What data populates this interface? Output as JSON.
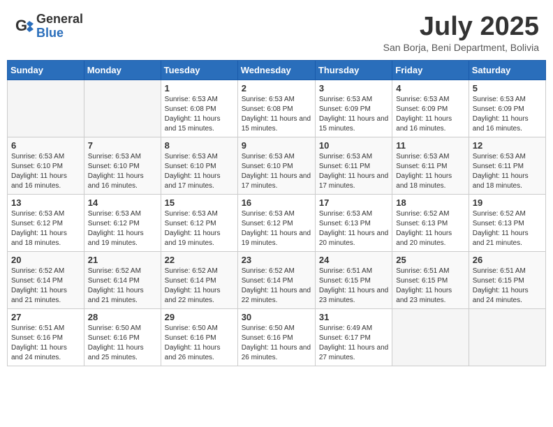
{
  "header": {
    "logo_general": "General",
    "logo_blue": "Blue",
    "month_title": "July 2025",
    "location": "San Borja, Beni Department, Bolivia"
  },
  "weekdays": [
    "Sunday",
    "Monday",
    "Tuesday",
    "Wednesday",
    "Thursday",
    "Friday",
    "Saturday"
  ],
  "weeks": [
    [
      {
        "day": "",
        "info": ""
      },
      {
        "day": "",
        "info": ""
      },
      {
        "day": "1",
        "info": "Sunrise: 6:53 AM\nSunset: 6:08 PM\nDaylight: 11 hours and 15 minutes."
      },
      {
        "day": "2",
        "info": "Sunrise: 6:53 AM\nSunset: 6:08 PM\nDaylight: 11 hours and 15 minutes."
      },
      {
        "day": "3",
        "info": "Sunrise: 6:53 AM\nSunset: 6:09 PM\nDaylight: 11 hours and 15 minutes."
      },
      {
        "day": "4",
        "info": "Sunrise: 6:53 AM\nSunset: 6:09 PM\nDaylight: 11 hours and 16 minutes."
      },
      {
        "day": "5",
        "info": "Sunrise: 6:53 AM\nSunset: 6:09 PM\nDaylight: 11 hours and 16 minutes."
      }
    ],
    [
      {
        "day": "6",
        "info": "Sunrise: 6:53 AM\nSunset: 6:10 PM\nDaylight: 11 hours and 16 minutes."
      },
      {
        "day": "7",
        "info": "Sunrise: 6:53 AM\nSunset: 6:10 PM\nDaylight: 11 hours and 16 minutes."
      },
      {
        "day": "8",
        "info": "Sunrise: 6:53 AM\nSunset: 6:10 PM\nDaylight: 11 hours and 17 minutes."
      },
      {
        "day": "9",
        "info": "Sunrise: 6:53 AM\nSunset: 6:10 PM\nDaylight: 11 hours and 17 minutes."
      },
      {
        "day": "10",
        "info": "Sunrise: 6:53 AM\nSunset: 6:11 PM\nDaylight: 11 hours and 17 minutes."
      },
      {
        "day": "11",
        "info": "Sunrise: 6:53 AM\nSunset: 6:11 PM\nDaylight: 11 hours and 18 minutes."
      },
      {
        "day": "12",
        "info": "Sunrise: 6:53 AM\nSunset: 6:11 PM\nDaylight: 11 hours and 18 minutes."
      }
    ],
    [
      {
        "day": "13",
        "info": "Sunrise: 6:53 AM\nSunset: 6:12 PM\nDaylight: 11 hours and 18 minutes."
      },
      {
        "day": "14",
        "info": "Sunrise: 6:53 AM\nSunset: 6:12 PM\nDaylight: 11 hours and 19 minutes."
      },
      {
        "day": "15",
        "info": "Sunrise: 6:53 AM\nSunset: 6:12 PM\nDaylight: 11 hours and 19 minutes."
      },
      {
        "day": "16",
        "info": "Sunrise: 6:53 AM\nSunset: 6:12 PM\nDaylight: 11 hours and 19 minutes."
      },
      {
        "day": "17",
        "info": "Sunrise: 6:53 AM\nSunset: 6:13 PM\nDaylight: 11 hours and 20 minutes."
      },
      {
        "day": "18",
        "info": "Sunrise: 6:52 AM\nSunset: 6:13 PM\nDaylight: 11 hours and 20 minutes."
      },
      {
        "day": "19",
        "info": "Sunrise: 6:52 AM\nSunset: 6:13 PM\nDaylight: 11 hours and 21 minutes."
      }
    ],
    [
      {
        "day": "20",
        "info": "Sunrise: 6:52 AM\nSunset: 6:14 PM\nDaylight: 11 hours and 21 minutes."
      },
      {
        "day": "21",
        "info": "Sunrise: 6:52 AM\nSunset: 6:14 PM\nDaylight: 11 hours and 21 minutes."
      },
      {
        "day": "22",
        "info": "Sunrise: 6:52 AM\nSunset: 6:14 PM\nDaylight: 11 hours and 22 minutes."
      },
      {
        "day": "23",
        "info": "Sunrise: 6:52 AM\nSunset: 6:14 PM\nDaylight: 11 hours and 22 minutes."
      },
      {
        "day": "24",
        "info": "Sunrise: 6:51 AM\nSunset: 6:15 PM\nDaylight: 11 hours and 23 minutes."
      },
      {
        "day": "25",
        "info": "Sunrise: 6:51 AM\nSunset: 6:15 PM\nDaylight: 11 hours and 23 minutes."
      },
      {
        "day": "26",
        "info": "Sunrise: 6:51 AM\nSunset: 6:15 PM\nDaylight: 11 hours and 24 minutes."
      }
    ],
    [
      {
        "day": "27",
        "info": "Sunrise: 6:51 AM\nSunset: 6:16 PM\nDaylight: 11 hours and 24 minutes."
      },
      {
        "day": "28",
        "info": "Sunrise: 6:50 AM\nSunset: 6:16 PM\nDaylight: 11 hours and 25 minutes."
      },
      {
        "day": "29",
        "info": "Sunrise: 6:50 AM\nSunset: 6:16 PM\nDaylight: 11 hours and 26 minutes."
      },
      {
        "day": "30",
        "info": "Sunrise: 6:50 AM\nSunset: 6:16 PM\nDaylight: 11 hours and 26 minutes."
      },
      {
        "day": "31",
        "info": "Sunrise: 6:49 AM\nSunset: 6:17 PM\nDaylight: 11 hours and 27 minutes."
      },
      {
        "day": "",
        "info": ""
      },
      {
        "day": "",
        "info": ""
      }
    ]
  ]
}
